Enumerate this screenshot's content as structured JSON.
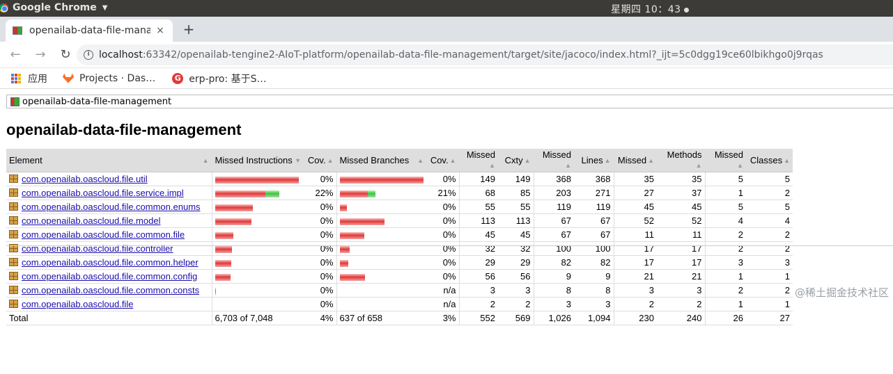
{
  "os": {
    "app_name": "Google Chrome",
    "clock": "星期四 10：43"
  },
  "tab": {
    "title": "openailab-data-file-management",
    "close": "×",
    "new_tab": "+"
  },
  "toolbar": {
    "back": "←",
    "forward": "→",
    "reload": "↻",
    "url_host": "localhost",
    "url_rest": ":63342/openailab-tengine2-AIoT-platform/openailab-data-file-management/target/site/jacoco/index.html?_ijt=5c0dgg19ce60lbikhgo0j9rqas"
  },
  "bookmarks": {
    "apps": "应用",
    "item1": "Projects · Das…",
    "item2": "erp-pro: 基于S…"
  },
  "report": {
    "breadcrumb": "openailab-data-file-management",
    "title": "openailab-data-file-management",
    "headers": {
      "element": "Element",
      "missed_instructions": "Missed Instructions",
      "cov1": "Cov.",
      "missed_branches": "Missed Branches",
      "cov2": "Cov.",
      "missed_cxty": "Missed",
      "cxty": "Cxty",
      "missed_lines": "Missed",
      "lines": "Lines",
      "missed_methods": "Missed",
      "methods": "Methods",
      "missed_classes": "Missed",
      "classes": "Classes"
    },
    "rows": [
      {
        "name": "com.openailab.oascloud.file.util",
        "instr_missed": 1,
        "instr_covered": 0,
        "instr_cov": "0%",
        "br_missed": 1,
        "br_covered": 0,
        "br_cov": "0%",
        "missed_cxty": "149",
        "cxty": "149",
        "missed_lines": "368",
        "lines": "368",
        "missed_methods": "35",
        "methods": "35",
        "missed_classes": "5",
        "classes": "5"
      },
      {
        "name": "com.openailab.oascloud.file.service.impl",
        "instr_missed": 0.6,
        "instr_covered": 0.17,
        "instr_cov": "22%",
        "br_missed": 0.33,
        "br_covered": 0.09,
        "br_cov": "21%",
        "missed_cxty": "68",
        "cxty": "85",
        "missed_lines": "203",
        "lines": "271",
        "missed_methods": "27",
        "methods": "37",
        "missed_classes": "1",
        "classes": "2"
      },
      {
        "name": "com.openailab.oascloud.file.common.enums",
        "instr_missed": 0.45,
        "instr_covered": 0,
        "instr_cov": "0%",
        "br_missed": 0.08,
        "br_covered": 0,
        "br_cov": "0%",
        "missed_cxty": "55",
        "cxty": "55",
        "missed_lines": "119",
        "lines": "119",
        "missed_methods": "45",
        "methods": "45",
        "missed_classes": "5",
        "classes": "5"
      },
      {
        "name": "com.openailab.oascloud.file.model",
        "instr_missed": 0.43,
        "instr_covered": 0,
        "instr_cov": "0%",
        "br_missed": 0.53,
        "br_covered": 0,
        "br_cov": "0%",
        "missed_cxty": "113",
        "cxty": "113",
        "missed_lines": "67",
        "lines": "67",
        "missed_methods": "52",
        "methods": "52",
        "missed_classes": "4",
        "classes": "4"
      },
      {
        "name": "com.openailab.oascloud.file.common.file",
        "instr_missed": 0.22,
        "instr_covered": 0,
        "instr_cov": "0%",
        "br_missed": 0.29,
        "br_covered": 0,
        "br_cov": "0%",
        "missed_cxty": "45",
        "cxty": "45",
        "missed_lines": "67",
        "lines": "67",
        "missed_methods": "11",
        "methods": "11",
        "missed_classes": "2",
        "classes": "2"
      },
      {
        "name": "com.openailab.oascloud.file.controller",
        "instr_missed": 0.2,
        "instr_covered": 0,
        "instr_cov": "0%",
        "br_missed": 0.12,
        "br_covered": 0,
        "br_cov": "0%",
        "missed_cxty": "32",
        "cxty": "32",
        "missed_lines": "100",
        "lines": "100",
        "missed_methods": "17",
        "methods": "17",
        "missed_classes": "2",
        "classes": "2"
      },
      {
        "name": "com.openailab.oascloud.file.common.helper",
        "instr_missed": 0.19,
        "instr_covered": 0,
        "instr_cov": "0%",
        "br_missed": 0.1,
        "br_covered": 0,
        "br_cov": "0%",
        "missed_cxty": "29",
        "cxty": "29",
        "missed_lines": "82",
        "lines": "82",
        "missed_methods": "17",
        "methods": "17",
        "missed_classes": "3",
        "classes": "3"
      },
      {
        "name": "com.openailab.oascloud.file.common.config",
        "instr_missed": 0.18,
        "instr_covered": 0,
        "instr_cov": "0%",
        "br_missed": 0.3,
        "br_covered": 0,
        "br_cov": "0%",
        "missed_cxty": "56",
        "cxty": "56",
        "missed_lines": "9",
        "lines": "9",
        "missed_methods": "21",
        "methods": "21",
        "missed_classes": "1",
        "classes": "1"
      },
      {
        "name": "com.openailab.oascloud.file.common.consts",
        "instr_missed": 0.01,
        "instr_covered": 0,
        "instr_cov": "0%",
        "br_missed": 0,
        "br_covered": 0,
        "br_cov": "n/a",
        "missed_cxty": "3",
        "cxty": "3",
        "missed_lines": "8",
        "lines": "8",
        "missed_methods": "3",
        "methods": "3",
        "missed_classes": "2",
        "classes": "2"
      },
      {
        "name": "com.openailab.oascloud.file",
        "instr_missed": 0,
        "instr_covered": 0,
        "instr_cov": "0%",
        "br_missed": 0,
        "br_covered": 0,
        "br_cov": "n/a",
        "missed_cxty": "2",
        "cxty": "2",
        "missed_lines": "3",
        "lines": "3",
        "missed_methods": "2",
        "methods": "2",
        "missed_classes": "1",
        "classes": "1"
      }
    ],
    "total": {
      "label": "Total",
      "instr": "6,703 of 7,048",
      "instr_cov": "4%",
      "br": "637 of 658",
      "br_cov": "3%",
      "missed_cxty": "552",
      "cxty": "569",
      "missed_lines": "1,026",
      "lines": "1,094",
      "missed_methods": "230",
      "methods": "240",
      "missed_classes": "26",
      "classes": "27"
    }
  },
  "watermark": "@稀土掘金技术社区"
}
